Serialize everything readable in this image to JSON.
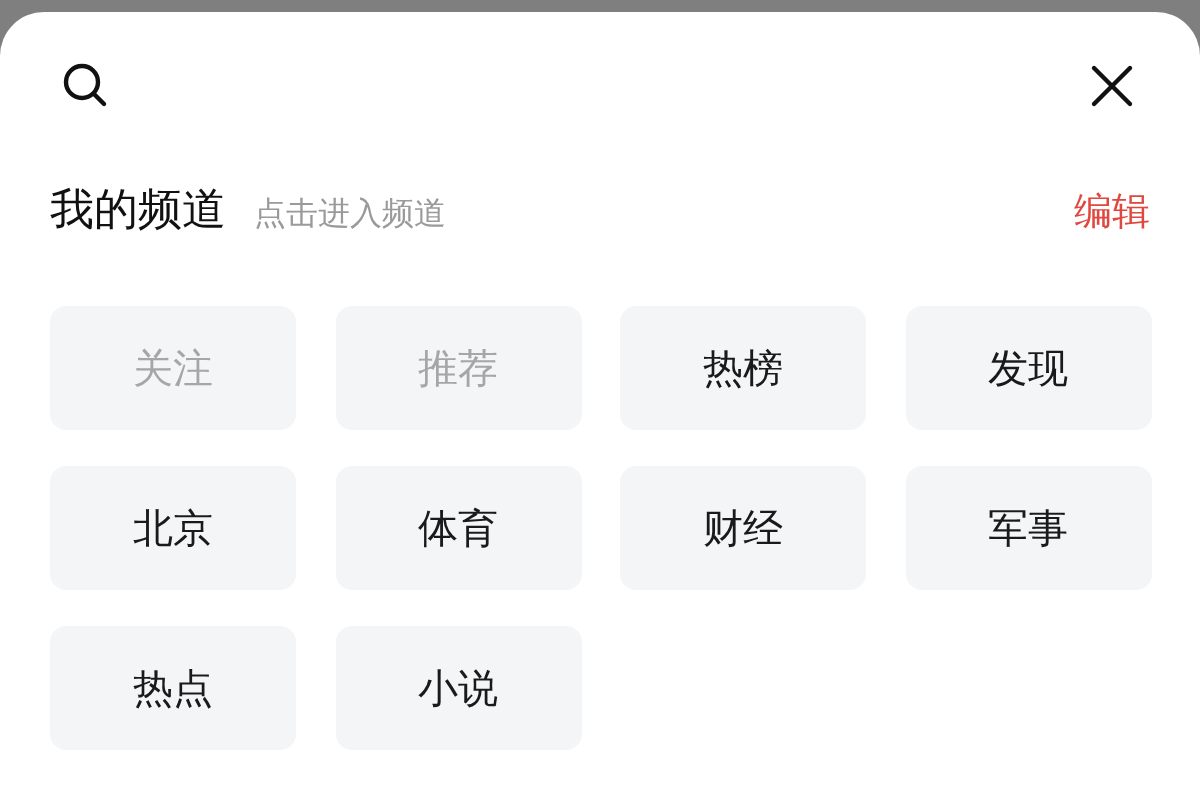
{
  "header": {
    "title": "我的频道",
    "hint": "点击进入频道",
    "edit": "编辑"
  },
  "channels": [
    {
      "label": "关注",
      "disabled": true
    },
    {
      "label": "推荐",
      "disabled": true
    },
    {
      "label": "热榜",
      "disabled": false
    },
    {
      "label": "发现",
      "disabled": false
    },
    {
      "label": "北京",
      "disabled": false
    },
    {
      "label": "体育",
      "disabled": false
    },
    {
      "label": "财经",
      "disabled": false
    },
    {
      "label": "军事",
      "disabled": false
    },
    {
      "label": "热点",
      "disabled": false
    },
    {
      "label": "小说",
      "disabled": false
    }
  ]
}
